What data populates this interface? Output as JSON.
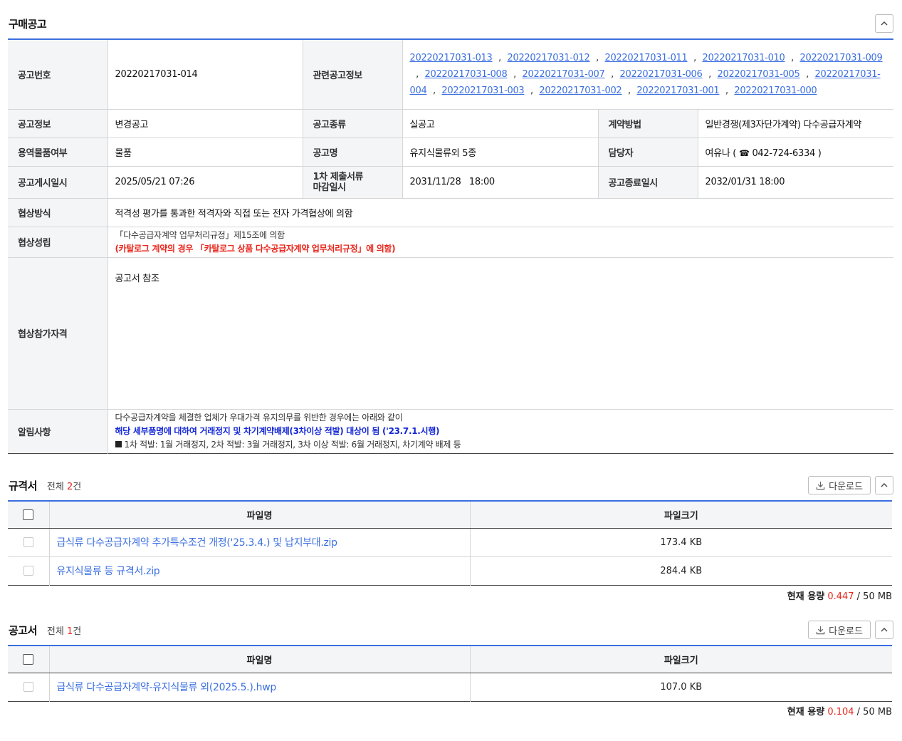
{
  "purchase": {
    "title": "구매공고",
    "rows": {
      "notice_no_label": "공고번호",
      "notice_no": "20220217031-014",
      "related_label": "관련공고정보",
      "related": [
        "20220217031-013",
        "20220217031-012",
        "20220217031-011",
        "20220217031-010",
        "20220217031-009",
        "20220217031-008",
        "20220217031-007",
        "20220217031-006",
        "20220217031-005",
        "20220217031-004",
        "20220217031-003",
        "20220217031-002",
        "20220217031-001",
        "20220217031-000"
      ],
      "related_sep": ",",
      "notice_info_label": "공고정보",
      "notice_info": "변경공고",
      "notice_kind_label": "공고종류",
      "notice_kind": "실공고",
      "contract_method_label": "계약방법",
      "contract_method": "일반경쟁(제3자단가계약) 다수공급자계약",
      "goods_label": "용역물품여부",
      "goods": "물품",
      "notice_name_label": "공고명",
      "notice_name": "유지식물류외 5종",
      "manager_label": "담당자",
      "manager_name": "여유나 (",
      "manager_phone": "042-724-6334 )",
      "post_date_label": "공고게시일시",
      "post_date": "2025/05/21 07:26",
      "deadline_label_1": "1차 제출서류",
      "deadline_label_2": "마감일시",
      "deadline": "2031/11/28   18:00",
      "end_date_label": "공고종료일시",
      "end_date": "2032/01/31 18:00",
      "negotiation_method_label": "협상방식",
      "negotiation_method": "적격성 평가를 통과한 적격자와 직접 또는 전자 가격협상에 의함",
      "negotiation_conclusion_label": "협상성립",
      "negotiation_conclusion_1": "「다수공급자계약 업무처리규정」제15조에 의함",
      "negotiation_conclusion_2": "(카탈로그 계약의 경우 「카탈로그 상품 다수공급자계약 업무처리규정」에 의함)",
      "qualification_label": "협상참가자격",
      "qualification": "공고서 참조",
      "notice_label": "알림사항",
      "notice_1": "다수공급자계약을 체결한 업체가 우대가격 유지의무를 위반한 경우에는 아래와 같이",
      "notice_2": "해당 세부품명에 대하여 거래정지 및 차기계약배제(3차이상 적발) 대상이 됨 ('23.7.1.시행)",
      "notice_3": "1차 적발: 1월 거래정지, 2차 적발: 3월 거래정지, 3차 이상 적발: 6월 거래정지, 차기계약 배제 등"
    }
  },
  "spec": {
    "title": "규격서",
    "count_prefix": "전체",
    "count": "2",
    "count_suffix": "건",
    "download_label": "다운로드",
    "col_name": "파일명",
    "col_size": "파일크기",
    "files": [
      {
        "name": "급식류 다수공급자계약 추가특수조건 개정('25.3.4.) 및 납지부대.zip",
        "size": "173.4 KB"
      },
      {
        "name": "유지식물류 등 규격서.zip",
        "size": "284.4 KB"
      }
    ],
    "capacity_label": "현재 용량",
    "capacity_used": "0.447",
    "capacity_total": "/ 50 MB"
  },
  "notice_doc": {
    "title": "공고서",
    "count_prefix": "전체",
    "count": "1",
    "count_suffix": "건",
    "download_label": "다운로드",
    "col_name": "파일명",
    "col_size": "파일크기",
    "files": [
      {
        "name": "급식류 다수공급자계약-유지식물류 외(2025.5.).hwp",
        "size": "107.0 KB"
      }
    ],
    "capacity_label": "현재 용량",
    "capacity_used": "0.104",
    "capacity_total": "/ 50 MB"
  },
  "colors": {
    "accent": "#3b6fe0",
    "red": "#e8271d",
    "blue_bold": "#1226d6"
  }
}
